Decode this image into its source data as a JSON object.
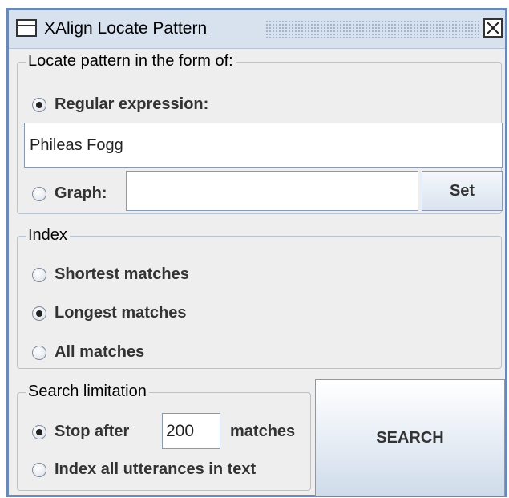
{
  "window": {
    "title": "XAlign Locate Pattern"
  },
  "locate_group": {
    "legend": "Locate pattern in the form of:",
    "regex_label": "Regular expression:",
    "regex_checked": true,
    "regex_value": "Phileas Fogg",
    "graph_label": "Graph:",
    "graph_checked": false,
    "graph_value": "",
    "set_button": "Set"
  },
  "index_group": {
    "legend": "Index",
    "options": [
      {
        "label": "Shortest matches",
        "checked": false
      },
      {
        "label": "Longest matches",
        "checked": true
      },
      {
        "label": "All matches",
        "checked": false
      }
    ]
  },
  "search_limit_group": {
    "legend": "Search limitation",
    "stop_after_label": "Stop after",
    "stop_after_checked": true,
    "stop_after_value": "200",
    "matches_label": "matches",
    "index_all_label": "Index all utterances in text",
    "index_all_checked": false
  },
  "search_button": "SEARCH",
  "icons": {
    "app": "window-icon",
    "close": "close-icon"
  }
}
